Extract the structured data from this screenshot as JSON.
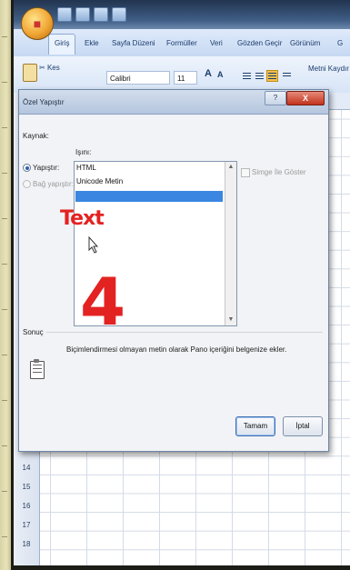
{
  "ribbon": {
    "tabs": [
      "Giriş",
      "Ekle",
      "Sayfa Düzeni",
      "Formüller",
      "Veri",
      "Gözden Geçir",
      "Görünüm",
      "G"
    ],
    "cut_label": "Kes",
    "font_name": "Calibri",
    "font_size": "11",
    "grow_font": "A",
    "shrink_font": "A",
    "wrap_text_label": "Metni Kaydır",
    "partial_label": "e O"
  },
  "sheet": {
    "row_numbers": [
      "14",
      "15",
      "16",
      "17",
      "18"
    ]
  },
  "dialog": {
    "title": "Özel Yapıştır",
    "source_label": "Kaynak:",
    "as_label": "Işını:",
    "paste_option": "Yapıştır:",
    "paste_link_option": "Bağ yapıştır:",
    "list_items": [
      "HTML",
      "Unicode Metin",
      "Text"
    ],
    "selected_index": 2,
    "show_icon_label": "Simge İle Göster",
    "result_label": "Sonuç",
    "result_text": "Biçimlendirmesi olmayan metin olarak Pano içeriğini belgenize ekler.",
    "ok_button": "Tamam",
    "cancel_button": "İptal",
    "help_button": "?",
    "close_button": "X"
  },
  "annotations": {
    "text_overlay": "Text",
    "step_number": "4",
    "color": "#e32222"
  }
}
